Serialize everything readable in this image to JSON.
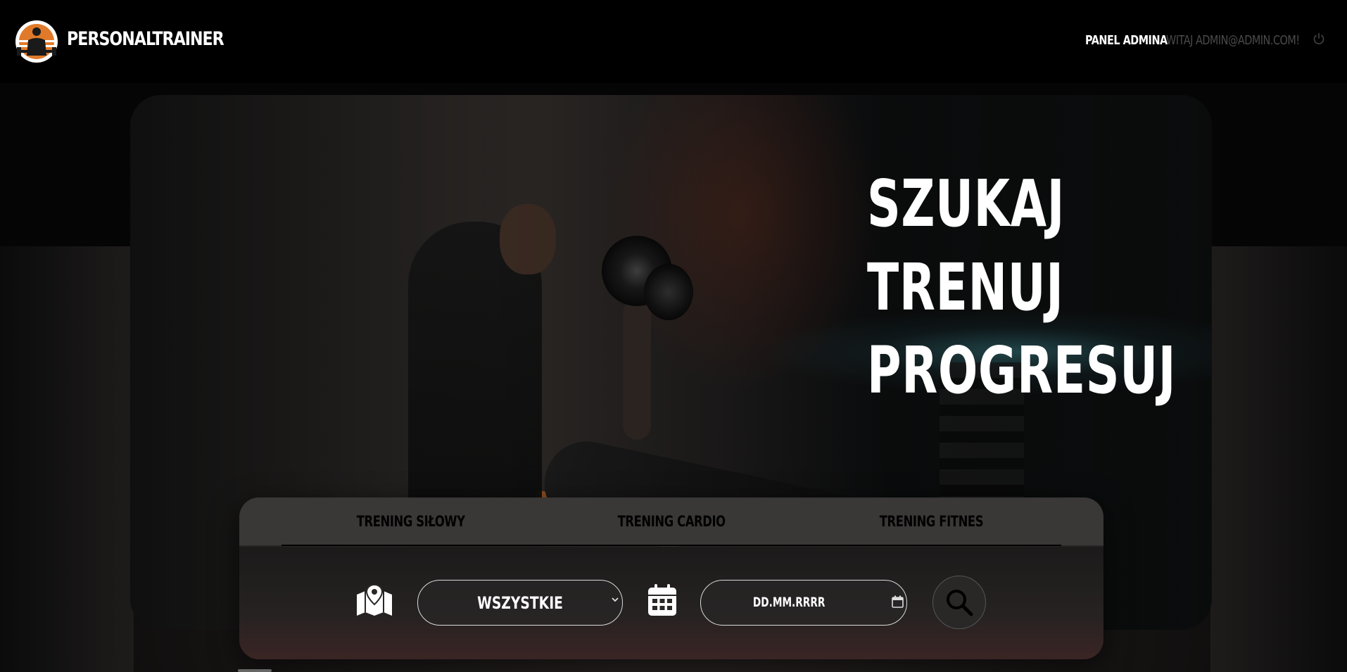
{
  "header": {
    "brand": "PERSONALTRAINER",
    "admin_panel_label": "PANEL ADMINA",
    "greeting": "WITAJ ADMIN@ADMIN.COM!",
    "logo_icon": "trainer-logo-icon",
    "logout_icon": "power-icon"
  },
  "hero": {
    "slogan": [
      "SZUKAJ",
      "TRENUJ",
      "PROGRESUJ"
    ]
  },
  "search": {
    "tabs": [
      "TRENING SIŁOWY",
      "TRENING CARDIO",
      "TRENING FITNES"
    ],
    "location_icon": "map-marker-icon",
    "location_value": "WSZYSTKIE",
    "date_icon": "calendar-icon",
    "date_placeholder": "DD.MM.RRRR",
    "search_icon": "search-icon"
  },
  "colors": {
    "background": "#000000",
    "text_primary": "#ffffff",
    "greeting_muted": "#4a4a4a",
    "panel": "#2d2a2a",
    "accent_teal": "#46a0aa",
    "accent_orange": "#a55a23"
  }
}
